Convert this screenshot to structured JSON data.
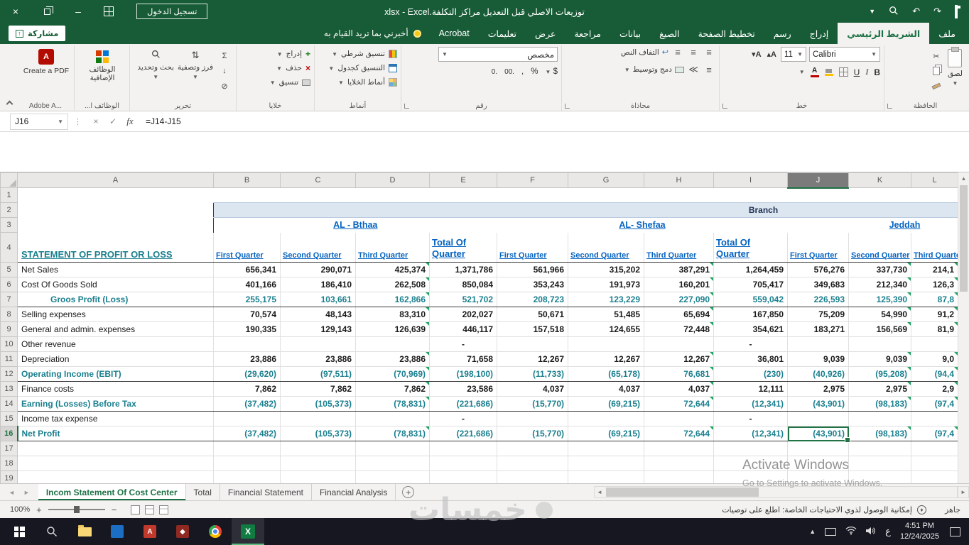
{
  "titlebar": {
    "window_title": "توزيعات الاصلي قبل التعديل مراكز التكلفة.xlsx - Excel",
    "sign_in_label": "تسجيل الدخول"
  },
  "ribbon": {
    "share_label": "مشاركة",
    "tell_me_label": "أخبرني بما تريد القيام به",
    "tabs": [
      {
        "label": "ملف"
      },
      {
        "label": "الشريط الرئيسي"
      },
      {
        "label": "إدراج"
      },
      {
        "label": "رسم"
      },
      {
        "label": "تخطيط الصفحة"
      },
      {
        "label": "الصيغ"
      },
      {
        "label": "بيانات"
      },
      {
        "label": "مراجعة"
      },
      {
        "label": "عرض"
      },
      {
        "label": "تعليمات"
      },
      {
        "label": "Acrobat"
      }
    ],
    "groups": {
      "clipboard": {
        "label": "الحافظة",
        "paste_label": "لصق"
      },
      "font": {
        "label": "خط",
        "font_name": "Calibri",
        "font_size": "11"
      },
      "alignment": {
        "label": "محاذاة",
        "wrap_label": "التفاف النص",
        "merge_label": "دمج وتوسيط"
      },
      "number": {
        "label": "رقم",
        "format_value": "مخصص"
      },
      "styles": {
        "label": "أنماط",
        "conditional_label": "تنسيق شرطي",
        "format_table_label": "التنسيق كجدول",
        "cell_styles_label": "أنماط الخلايا"
      },
      "cells": {
        "label": "خلايا",
        "insert_label": "إدراج",
        "delete_label": "حذف",
        "format_label": "تنسيق"
      },
      "editing": {
        "label": "تحرير",
        "sort_label": "فرز وتصفية",
        "find_label": "بحث وتحديد"
      },
      "addins": {
        "label": "الوظائف ا...",
        "button_label": "الوظائف الإضافية"
      },
      "adobe": {
        "label": "Adobe A...",
        "button_label": "Create a PDF"
      }
    }
  },
  "formula_bar": {
    "name_box": "J16",
    "formula": "=J14-J15"
  },
  "grid": {
    "column_letters": [
      "A",
      "B",
      "C",
      "D",
      "E",
      "F",
      "G",
      "H",
      "I",
      "J",
      "K",
      "L"
    ],
    "row_numbers": [
      "1",
      "2",
      "3",
      "4",
      "5",
      "6",
      "7",
      "8",
      "9",
      "10",
      "11",
      "12",
      "13",
      "14",
      "15",
      "16",
      "17",
      "18",
      "19"
    ],
    "branch_header": "Branch",
    "branches": {
      "b1": "AL - Bthaa",
      "b2": "AL- Shefaa",
      "b3": "Jeddah"
    },
    "statement_title": "STATEMENT OF PROFIT OR LOSS",
    "quarter_headers": [
      "First Quarter",
      "Second Quarter",
      "Third Quarter",
      "Total Of Quarter",
      "First Quarter",
      "Second Quarter",
      "Third Quarter",
      "Total Of Quarter",
      "First Quarter",
      "Second Quarter",
      "Third Quarter"
    ],
    "rows": [
      {
        "n": 5,
        "label": "Net Sales",
        "style": "normal",
        "values": [
          "656,341",
          "290,071",
          "425,374",
          "1,371,786",
          "561,966",
          "315,202",
          "387,291",
          "1,264,459",
          "576,276",
          "337,730",
          "214,1"
        ]
      },
      {
        "n": 6,
        "label": "Cost Of Goods Sold",
        "style": "normal",
        "values": [
          "401,166",
          "186,410",
          "262,508",
          "850,084",
          "353,243",
          "191,973",
          "160,201",
          "705,417",
          "349,683",
          "212,340",
          "126,3"
        ]
      },
      {
        "n": 7,
        "label": "Groos Profit (Loss)",
        "style": "subtotal",
        "indent": true,
        "values": [
          "255,175",
          "103,661",
          "162,866",
          "521,702",
          "208,723",
          "123,229",
          "227,090",
          "559,042",
          "226,593",
          "125,390",
          "87,8"
        ]
      },
      {
        "n": 8,
        "label": "Selling expenses",
        "style": "normal",
        "values": [
          "70,574",
          "48,143",
          "83,310",
          "202,027",
          "50,671",
          "51,485",
          "65,694",
          "167,850",
          "75,209",
          "54,990",
          "91,2"
        ]
      },
      {
        "n": 9,
        "label": "General and admin. expenses",
        "style": "normal",
        "values": [
          "190,335",
          "129,143",
          "126,639",
          "446,117",
          "157,518",
          "124,655",
          "72,448",
          "354,621",
          "183,271",
          "156,569",
          "81,9"
        ]
      },
      {
        "n": 10,
        "label": "Other revenue",
        "style": "normal",
        "values": [
          "",
          "",
          "",
          "-",
          "",
          "",
          "",
          "-",
          "",
          "",
          ""
        ]
      },
      {
        "n": 11,
        "label": "Depreciation",
        "style": "normal",
        "values": [
          "23,886",
          "23,886",
          "23,886",
          "71,658",
          "12,267",
          "12,267",
          "12,267",
          "36,801",
          "9,039",
          "9,039",
          "9,0"
        ]
      },
      {
        "n": 12,
        "label": "Operating Income (EBIT)",
        "style": "subtotal",
        "values": [
          "(29,620)",
          "(97,511)",
          "(70,969)",
          "(198,100)",
          "(11,733)",
          "(65,178)",
          "76,681",
          "(230)",
          "(40,926)",
          "(95,208)",
          "(94,4"
        ]
      },
      {
        "n": 13,
        "label": "Finance costs",
        "style": "normal",
        "values": [
          "7,862",
          "7,862",
          "7,862",
          "23,586",
          "4,037",
          "4,037",
          "4,037",
          "12,111",
          "2,975",
          "2,975",
          "2,9"
        ]
      },
      {
        "n": 14,
        "label": "Earning (Losses) Before Tax",
        "style": "subtotal",
        "values": [
          "(37,482)",
          "(105,373)",
          "(78,831)",
          "(221,686)",
          "(15,770)",
          "(69,215)",
          "72,644",
          "(12,341)",
          "(43,901)",
          "(98,183)",
          "(97,4"
        ]
      },
      {
        "n": 15,
        "label": "Income tax expense",
        "style": "normal",
        "values": [
          "",
          "",
          "",
          "-",
          "",
          "",
          "",
          "-",
          "",
          "",
          ""
        ]
      },
      {
        "n": 16,
        "label": "Net Profit",
        "style": "subtotal",
        "values": [
          "(37,482)",
          "(105,373)",
          "(78,831)",
          "(221,686)",
          "(15,770)",
          "(69,215)",
          "72,644",
          "(12,341)",
          "(43,901)",
          "(98,183)",
          "(97,4"
        ]
      }
    ],
    "selected_cell": {
      "ref": "J16",
      "col": "J",
      "row": 16
    }
  },
  "sheet_tabs": {
    "tabs": [
      {
        "label": "Incom Statement Of Cost Center",
        "active": true
      },
      {
        "label": "Total"
      },
      {
        "label": "Financial Statement"
      },
      {
        "label": "Financial Analysis"
      }
    ]
  },
  "status_bar": {
    "zoom_level": "100%",
    "ready_label": "جاهز",
    "accessibility_label": "إمكانية الوصول لذوي الاحتياجات الخاصة: اطلع على توصيات"
  },
  "taskbar": {
    "time": "4:51 PM",
    "date": "12/24/2025",
    "language": "ع"
  },
  "watermarks": {
    "khamsat": "خمسات",
    "activate_line1": "Activate Windows",
    "activate_line2": "Go to Settings to activate Windows."
  }
}
